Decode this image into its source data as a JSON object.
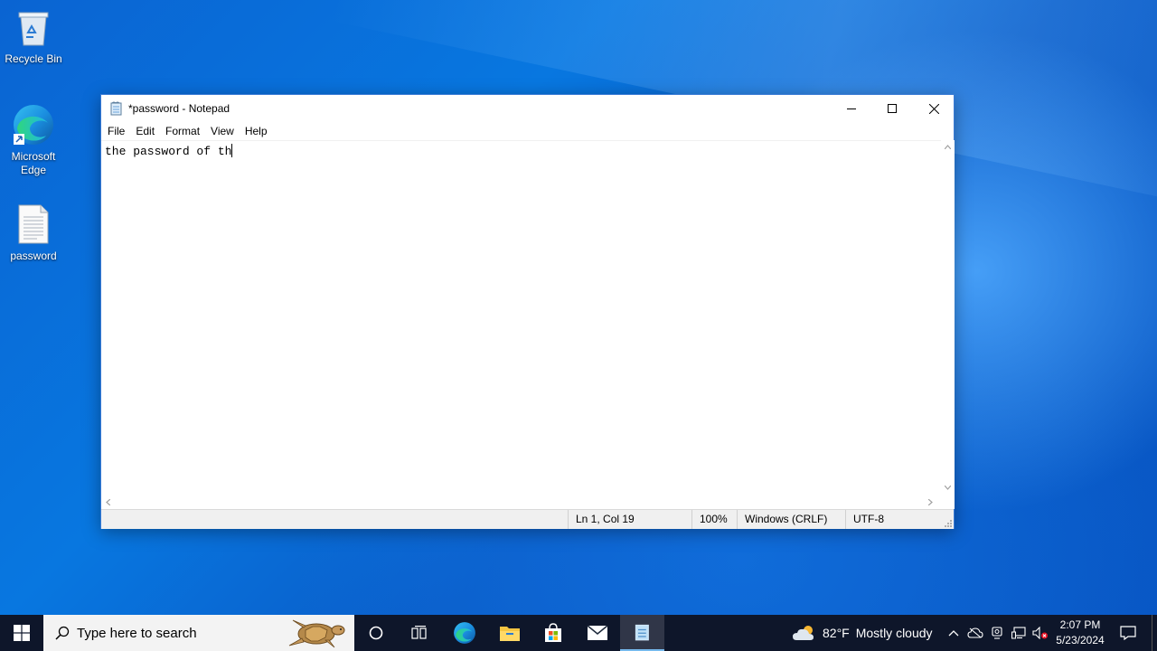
{
  "desktop": {
    "icons": [
      {
        "label": "Recycle Bin"
      },
      {
        "label": "Microsoft Edge"
      },
      {
        "label": "password"
      }
    ]
  },
  "notepad": {
    "title": "*password - Notepad",
    "menu": [
      "File",
      "Edit",
      "Format",
      "View",
      "Help"
    ],
    "content": "the password of th",
    "status": {
      "position": "Ln 1, Col 19",
      "zoom": "100%",
      "line_ending": "Windows (CRLF)",
      "encoding": "UTF-8"
    }
  },
  "taskbar": {
    "search_placeholder": "Type here to search",
    "weather": {
      "temp": "82°F",
      "condition": "Mostly cloudy"
    },
    "clock": {
      "time": "2:07 PM",
      "date": "5/23/2024"
    }
  },
  "colors": {
    "taskbar_bg": "#0e1424",
    "window_border": "#3a7bd5",
    "active_indicator": "#76b9ed"
  }
}
